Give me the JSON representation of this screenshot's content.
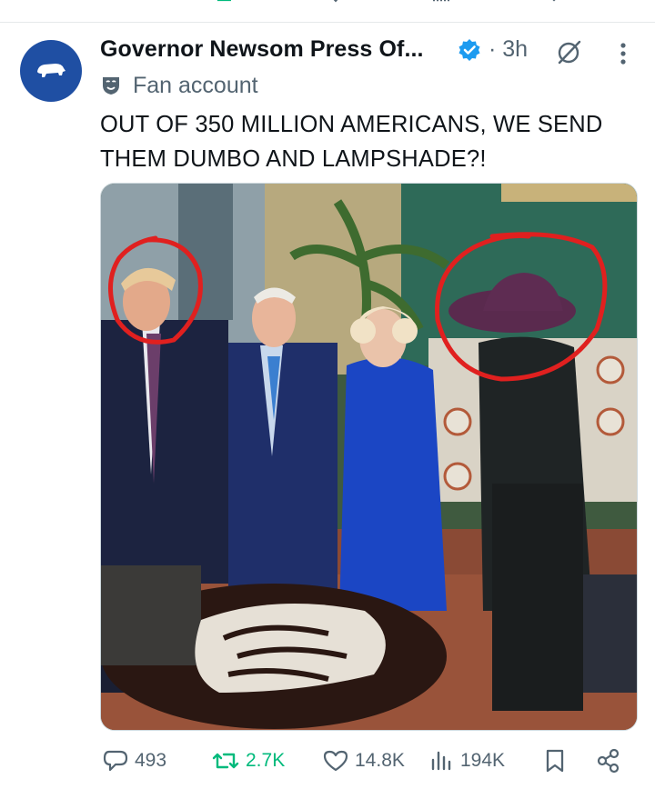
{
  "tweet": {
    "author_name": "Governor Newsom Press Of...",
    "time": "· 3h",
    "label": "Fan account",
    "text": "OUT OF 350 MILLION AMERICANS, WE SEND THEM DUMBO AND LAMPSHADE?!"
  },
  "actions": {
    "replies": "493",
    "reposts": "2.7K",
    "likes": "14.8K",
    "views": "194K"
  },
  "icons": {
    "previous_row": [
      "reply-icon",
      "repost-icon",
      "like-icon",
      "views-icon",
      "bookmark-icon",
      "share-icon"
    ],
    "header": [
      "verified-badge-icon",
      "grok-icon",
      "more-options-icon"
    ],
    "label": "fan-account-mask-icon",
    "action_bar": [
      "reply-icon",
      "repost-icon",
      "like-icon",
      "views-icon",
      "bookmark-icon",
      "share-icon"
    ]
  },
  "colors": {
    "text_primary": "#0f1419",
    "text_secondary": "#536471",
    "verified": "#1d9bf0",
    "repost_active": "#00ba7c",
    "avatar_bg": "#1f4fa3",
    "circle_annotation": "#e0201f"
  }
}
